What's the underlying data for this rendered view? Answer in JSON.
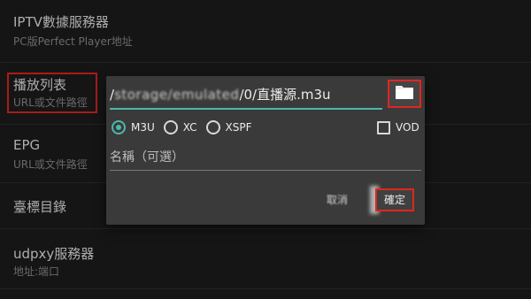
{
  "settings": {
    "items": [
      {
        "title": "IPTV數據服務器",
        "subtitle": "PC版Perfect Player地址"
      },
      {
        "title": "播放列表",
        "subtitle": "URL或文件路徑"
      },
      {
        "title": "EPG",
        "subtitle": "URL或文件路徑"
      },
      {
        "title": "臺標目錄",
        "subtitle": ""
      },
      {
        "title": "udpxy服務器",
        "subtitle": "地址:端口"
      }
    ]
  },
  "dialog": {
    "path_prefix": "/",
    "path_obscured": "storage/emulated",
    "path_suffix": "/0/直播源.m3u",
    "formats": [
      "M3U",
      "XC",
      "XSPF"
    ],
    "selected_format": "M3U",
    "vod_label": "VOD",
    "vod_checked": false,
    "name_placeholder": "名稱（可選）",
    "cancel_label": "取消",
    "confirm_label": "確定"
  },
  "icons": {
    "folder": "folder-icon"
  },
  "colors": {
    "background": "#1c1c1c",
    "dialog": "#3a3a3a",
    "accent": "#4db6ac",
    "annotation": "#e0261f"
  }
}
